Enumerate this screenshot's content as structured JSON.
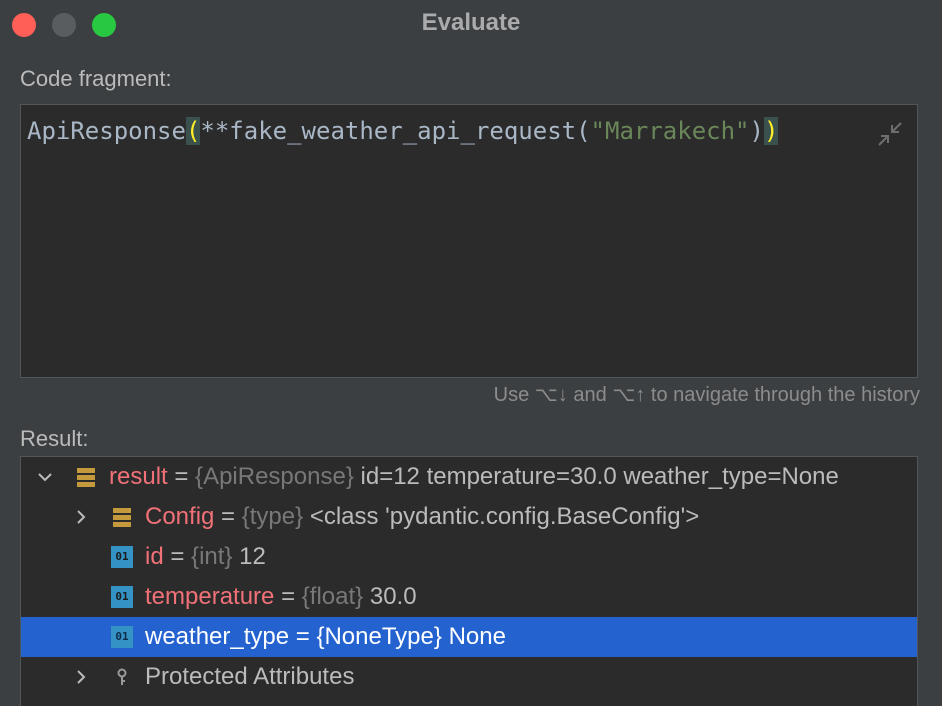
{
  "window": {
    "title": "Evaluate"
  },
  "code_fragment": {
    "label": "Code fragment:",
    "tokens": {
      "class_name": "ApiResponse",
      "open_paren": "(",
      "star": "**fake_weather_api_request(",
      "string": "\"Marrakech\"",
      "inner_close": ")",
      "close_paren": ")"
    }
  },
  "hint": "Use ⌥↓ and ⌥↑ to navigate through the history",
  "result": {
    "label": "Result:",
    "rows": [
      {
        "name": "result",
        "eq": "=",
        "type": "{ApiResponse}",
        "value": "id=12 temperature=30.0 weather_type=None"
      },
      {
        "name": "Config",
        "eq": "=",
        "type": "{type}",
        "value": "<class 'pydantic.config.BaseConfig'>"
      },
      {
        "name": "id",
        "eq": "=",
        "type": "{int}",
        "value": "12"
      },
      {
        "name": "temperature",
        "eq": "=",
        "type": "{float}",
        "value": "30.0"
      },
      {
        "name": "weather_type",
        "eq": "=",
        "type": "{NoneType}",
        "value": "None"
      },
      {
        "name": "Protected Attributes"
      }
    ],
    "selected_row": "weather_type"
  },
  "icons": {
    "object": "object-icon",
    "primitive": "primitive-01-icon",
    "protected": "key-icon",
    "collapse": "collapse-editor-icon",
    "expand": "chevron-right-icon",
    "expanded": "chevron-down-icon"
  },
  "colors": {
    "background": "#3c3f41",
    "editor_bg": "#2b2b2b",
    "string": "#6a8759",
    "paren_highlight": "#ffef28",
    "variable_name": "#f07178",
    "selection": "#2463cf",
    "primitive_icon": "#3592c4",
    "object_icon": "#c49a3c"
  }
}
